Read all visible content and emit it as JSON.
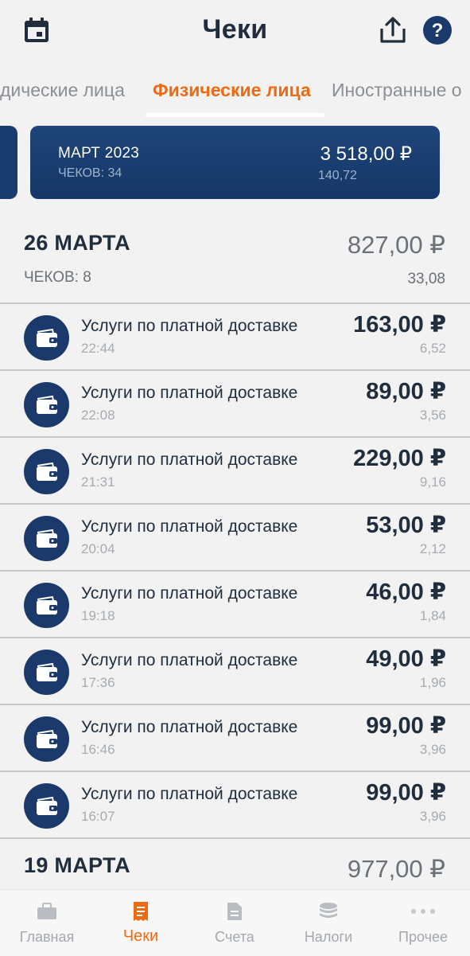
{
  "header": {
    "title": "Чеки",
    "icons": [
      "calendar-icon",
      "share-icon",
      "help-icon"
    ],
    "help_glyph": "?"
  },
  "tabs": [
    {
      "label": "дические лица",
      "active": false
    },
    {
      "label": "Физические лица",
      "active": true
    },
    {
      "label": "Иностранные о",
      "active": false
    }
  ],
  "summary": {
    "month": "МАРТ 2023",
    "count": "ЧЕКОВ: 34",
    "amount": "3 518,00 ₽",
    "tax": "140,72"
  },
  "day1": {
    "title": "26 МАРТА",
    "count": "ЧЕКОВ: 8",
    "amount": "827,00 ₽",
    "tax": "33,08"
  },
  "receipts": [
    {
      "title": "Услуги по платной доставке",
      "time": "22:44",
      "amount": "163,00 ₽",
      "tax": "6,52"
    },
    {
      "title": "Услуги по платной доставке",
      "time": "22:08",
      "amount": "89,00 ₽",
      "tax": "3,56"
    },
    {
      "title": "Услуги по платной доставке",
      "time": "21:31",
      "amount": "229,00 ₽",
      "tax": "9,16"
    },
    {
      "title": "Услуги по платной доставке",
      "time": "20:04",
      "amount": "53,00 ₽",
      "tax": "2,12"
    },
    {
      "title": "Услуги по платной доставке",
      "time": "19:18",
      "amount": "46,00 ₽",
      "tax": "1,84"
    },
    {
      "title": "Услуги по платной доставке",
      "time": "17:36",
      "amount": "49,00 ₽",
      "tax": "1,96"
    },
    {
      "title": "Услуги по платной доставке",
      "time": "16:46",
      "amount": "99,00 ₽",
      "tax": "3,96"
    },
    {
      "title": "Услуги по платной доставке",
      "time": "16:07",
      "amount": "99,00 ₽",
      "tax": "3,96"
    }
  ],
  "day2": {
    "title": "19 МАРТА",
    "amount": "977,00 ₽"
  },
  "bottom_nav": [
    {
      "label": "Главная",
      "icon": "briefcase-icon",
      "active": false
    },
    {
      "label": "Чеки",
      "icon": "receipt-icon",
      "active": true
    },
    {
      "label": "Счета",
      "icon": "document-icon",
      "active": false
    },
    {
      "label": "Налоги",
      "icon": "coins-icon",
      "active": false
    },
    {
      "label": "Прочее",
      "icon": "more-icon",
      "active": false
    }
  ],
  "colors": {
    "accent": "#f06a0f",
    "brand_navy": "#1b3a6b",
    "background": "#f2f2f2"
  }
}
